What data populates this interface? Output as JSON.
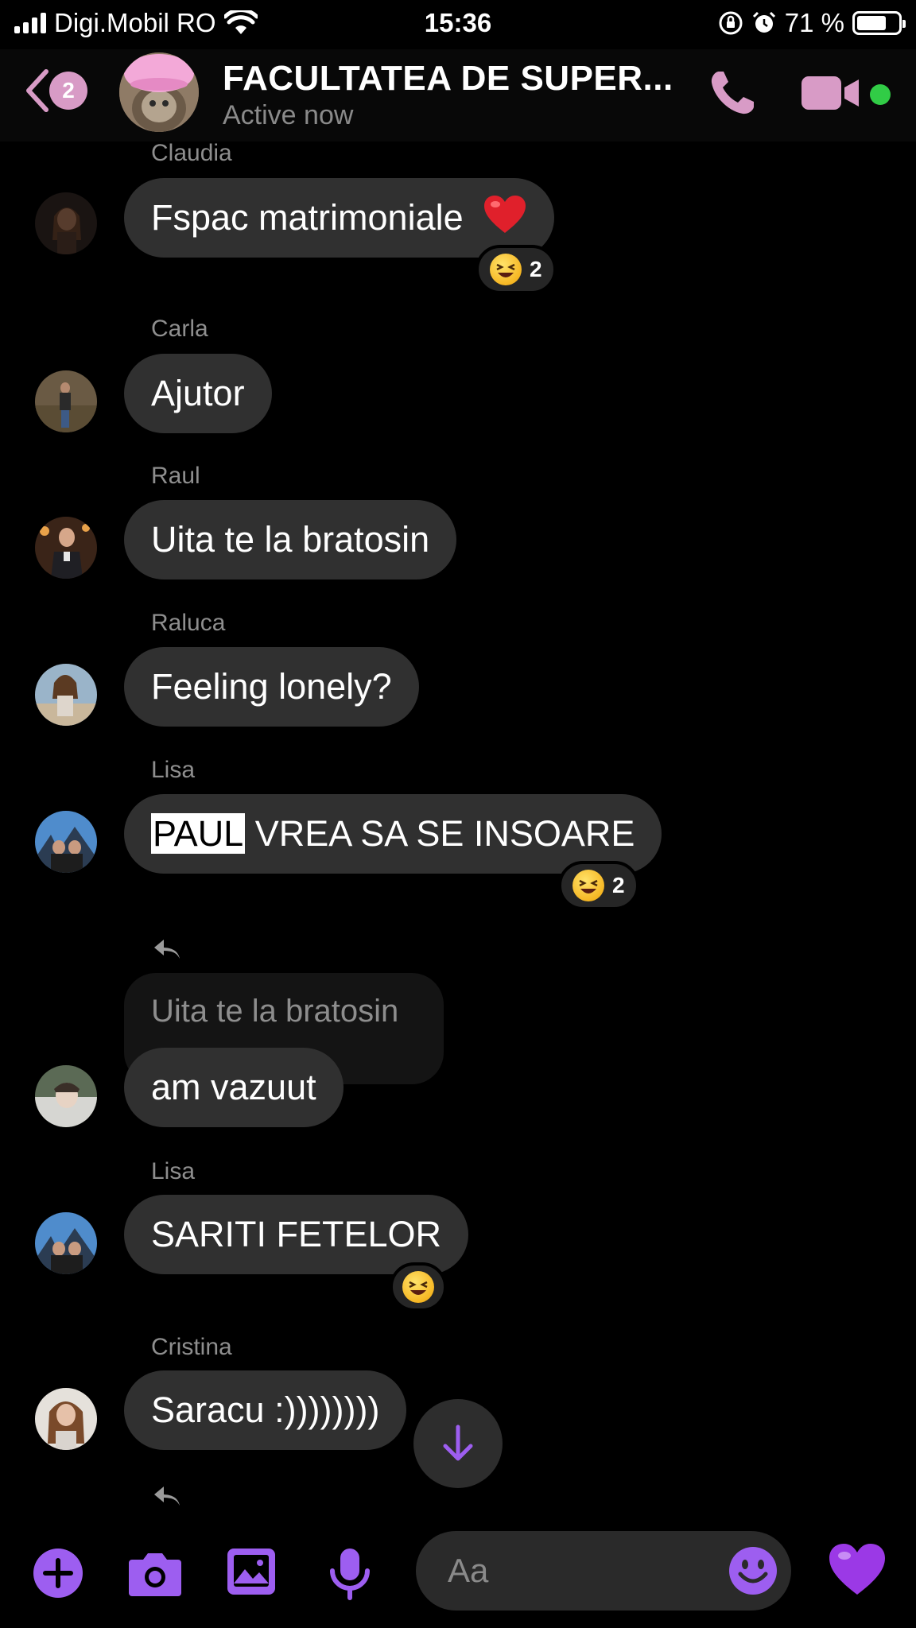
{
  "status_bar": {
    "carrier": "Digi.Mobil RO",
    "time": "15:36",
    "battery_percent": "71 %",
    "battery_level": 0.71
  },
  "header": {
    "back_badge_count": "2",
    "title": "FACULTATEA DE SUPER...",
    "subtitle": "Active now",
    "accent_color": "#d89bc6",
    "online_color": "#31cc46"
  },
  "messages": [
    {
      "sender": "Claudia",
      "text": "Fspac matrimoniale",
      "emoji_icon": "red-heart",
      "reaction_icon": "laughing-face",
      "reaction_count": "2"
    },
    {
      "sender": "Carla",
      "text": "Ajutor"
    },
    {
      "sender": "Raul",
      "text": "Uita te la bratosin"
    },
    {
      "sender": "Raluca",
      "text": "Feeling lonely?"
    },
    {
      "sender": "Lisa",
      "text_highlight": "PAUL",
      "text_rest": " VREA SA SE INSOARE",
      "reaction_icon": "laughing-face",
      "reaction_count": "2"
    },
    {
      "quoted_text": "Uita te la bratosin",
      "text": "am vazuut",
      "reply_icon": "reply-arrow"
    },
    {
      "sender": "Lisa",
      "text": "SARITI FETELOR",
      "reaction_icon": "laughing-face"
    },
    {
      "sender": "Cristina",
      "text": "Saracu :))))))))"
    }
  ],
  "composer": {
    "placeholder": "Aa",
    "icons": [
      "plus-icon",
      "camera-icon",
      "gallery-icon",
      "microphone-icon",
      "emoji-icon",
      "purple-heart-icon"
    ],
    "accent_color": "#9d5ef0"
  }
}
